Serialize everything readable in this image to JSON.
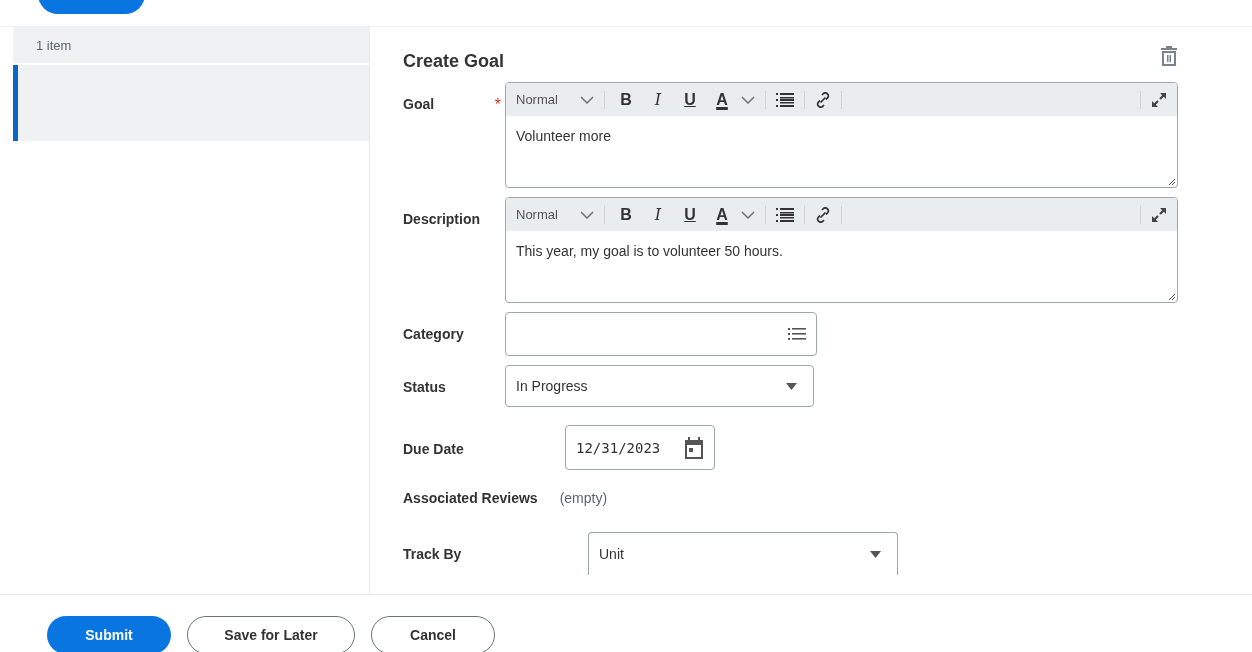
{
  "sidebar": {
    "count": "1 item",
    "items": [
      {
        "selected": true
      }
    ]
  },
  "form": {
    "title": "Create Goal",
    "fields": [
      {
        "kind": "richtext",
        "label": "Goal",
        "required_mark": "*",
        "format": "Normal",
        "tools": [
          "B",
          "I",
          "U",
          "A"
        ],
        "value": "Volunteer more"
      },
      {
        "kind": "richtext",
        "label": "Description",
        "format": "Normal",
        "tools": [
          "B",
          "I",
          "U",
          "A"
        ],
        "value": "This year, my goal is to volunteer 50 hours."
      },
      {
        "kind": "prompt",
        "label": "Category"
      },
      {
        "kind": "select",
        "label": "Status",
        "value": "In Progress"
      },
      {
        "kind": "date",
        "label": "Due Date",
        "value": "12/31/2023"
      },
      {
        "kind": "readonly",
        "label": "Associated Reviews",
        "value": "(empty)"
      },
      {
        "kind": "select-wide",
        "label": "Track By",
        "value": "Unit"
      }
    ]
  },
  "buttons": [
    {
      "label": "Submit",
      "kind": "primary"
    },
    {
      "label": "Save for Later",
      "kind": "secondary"
    },
    {
      "label": "Cancel",
      "kind": "secondary"
    }
  ]
}
